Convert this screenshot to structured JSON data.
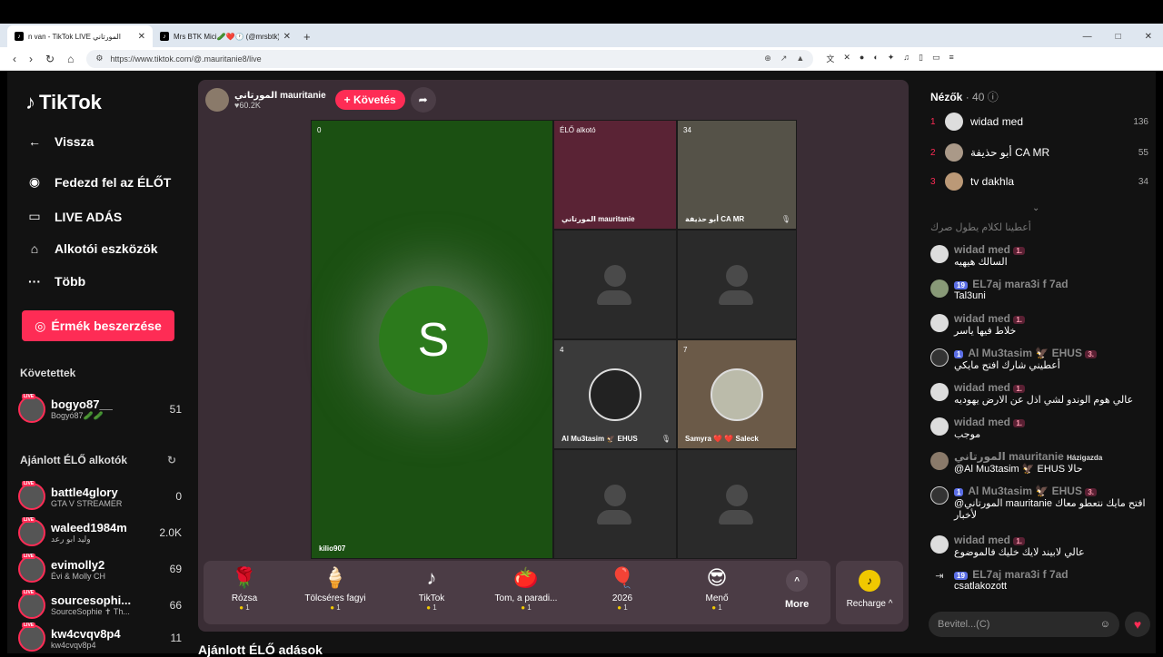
{
  "browser": {
    "tabs": [
      {
        "label": "n van - TikTok LIVE المورتاني",
        "active": true
      },
      {
        "label": "Mrs BTK Mici🥒❤️🕐 (@mrsbtk) É",
        "active": false
      }
    ],
    "url": "https://www.tiktok.com/@.mauritanie8/live"
  },
  "sidebar": {
    "logo": "TikTok",
    "nav": [
      {
        "label": "Vissza",
        "icon": "back-arrow-icon"
      },
      {
        "label": "Fedezd fel az ÉLŐT",
        "icon": "explore-live-icon"
      },
      {
        "label": "LIVE ADÁS",
        "icon": "camera-icon"
      },
      {
        "label": "Alkotói eszközök",
        "icon": "creator-tools-icon"
      },
      {
        "label": "Több",
        "icon": "more-dots-icon"
      }
    ],
    "coin_button": "Érmék beszerzése",
    "followed_title": "Követettek",
    "followed": [
      {
        "name": "bogyo87__",
        "sub": "Bogyó87🥒🥒",
        "count": "51"
      }
    ],
    "recommended_title": "Ajánlott ÉLŐ alkotók",
    "recommended": [
      {
        "name": "battle4glory",
        "sub": "GTA V STREAMER",
        "count": "0"
      },
      {
        "name": "waleed1984m",
        "sub": "وليد ابو رعد",
        "count": "2.0K"
      },
      {
        "name": "evimolly2",
        "sub": "Évi & Molly CH",
        "count": "69"
      },
      {
        "name": "sourcesophi...",
        "sub": "SourceSophie ✝ Th...",
        "count": "66"
      },
      {
        "name": "kw4cvqv8p4",
        "sub": "kw4cvqv8p4",
        "count": "11"
      }
    ]
  },
  "host": {
    "name": "المورتاني mauritanie",
    "likes": "♥60.2K",
    "follow_label": "+ Követés"
  },
  "grid": {
    "main": {
      "badge": "0",
      "initial": "S",
      "caption": "kilio907"
    },
    "tiles": [
      {
        "badge": "ÉLŐ alkotó",
        "caption": "المورتاني mauritanie"
      },
      {
        "badge": "34",
        "caption": "أبو حذيفة CA MR"
      },
      {
        "badge": "4",
        "caption": "Al Mu3tasim 🦅 EHUS"
      },
      {
        "badge": "7",
        "caption": "Samyra ❤️ ❤️ Saleck"
      }
    ]
  },
  "gifts": [
    {
      "icon": "🌹",
      "name": "Rózsa",
      "price": "1"
    },
    {
      "icon": "🍦",
      "name": "Tölcséres fagyi",
      "price": "1"
    },
    {
      "icon": "♪",
      "name": "TikTok",
      "price": "1"
    },
    {
      "icon": "🍅",
      "name": "Tom, a paradi...",
      "price": "1"
    },
    {
      "icon": "🎈",
      "name": "2026",
      "price": "1"
    },
    {
      "icon": "😎",
      "name": "Menő",
      "price": "1"
    }
  ],
  "gift_more": "More",
  "recharge": "Recharge ^",
  "recommend_title": "Ajánlott ÉLŐ adások",
  "viewers": {
    "title": "Nézők",
    "count": "· 40",
    "list": [
      {
        "rank": "1",
        "name": "widad med",
        "score": "136"
      },
      {
        "rank": "2",
        "name": "أبو حذيفة CA MR",
        "score": "55"
      },
      {
        "rank": "3",
        "name": "tv dakhla",
        "score": "34"
      }
    ]
  },
  "chat": [
    {
      "name": "",
      "tags": [],
      "text": "أعطينا لكلام يطول صرك"
    },
    {
      "name": "widad med",
      "tags": [
        "1."
      ],
      "text": "السالك هيهيه"
    },
    {
      "name": "EL7aj mara3i f 7ad",
      "tags": [
        "19"
      ],
      "text": "Tal3uni"
    },
    {
      "name": "widad med",
      "tags": [
        "1."
      ],
      "text": "خلاط فيها ياسر"
    },
    {
      "name": "Al Mu3tasim 🦅 EHUS",
      "tags": [
        "1",
        "3."
      ],
      "text": "أعطيني شارك افتح مايكي"
    },
    {
      "name": "widad med",
      "tags": [
        "1."
      ],
      "text": "عالي هوم الوندو لشي اذل عن الارض يهوديه"
    },
    {
      "name": "widad med",
      "tags": [
        "1."
      ],
      "text": "موجب"
    },
    {
      "name": "المورتاني mauritanie",
      "tags": [
        "Házigazda"
      ],
      "text": "@Al Mu3tasim 🦅 EHUS حالا"
    },
    {
      "name": "Al Mu3tasim 🦅 EHUS",
      "tags": [
        "1",
        "3."
      ],
      "text": "@المورتاني mauritanie افتح مايك نتعطو معاك لأخبار"
    },
    {
      "name": "widad med",
      "tags": [
        "1."
      ],
      "text": "عالي لابيند لايك خليك فالموضوع"
    },
    {
      "name": "EL7aj mara3i f 7ad",
      "tags": [
        "19"
      ],
      "text": "csatlakozott"
    }
  ],
  "chat_input_placeholder": "Bevitel...(C)"
}
